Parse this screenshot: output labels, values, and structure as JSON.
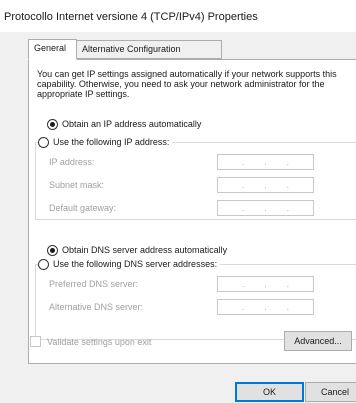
{
  "window": {
    "title": "Protocollo Internet versione 4 (TCP/IPv4) Properties"
  },
  "tabs": [
    {
      "label": "General",
      "selected": true
    },
    {
      "label": "Alternative Configuration",
      "selected": false
    }
  ],
  "description": "You can get IP settings assigned automatically if your network supports this capability. Otherwise, you need to ask your network administrator for the appropriate IP settings.",
  "ip_section": {
    "auto_label": "Obtain an IP address automatically",
    "auto_selected": true,
    "manual_label": "Use the following IP address:",
    "manual_selected": false,
    "fields": [
      {
        "label": "IP address:",
        "value": ". . ."
      },
      {
        "label": "Subnet mask:",
        "value": ". . ."
      },
      {
        "label": "Default gateway:",
        "value": ". . ."
      }
    ]
  },
  "dns_section": {
    "auto_label": "Obtain DNS server address automatically",
    "auto_selected": true,
    "manual_label": "Use the following DNS server addresses:",
    "manual_selected": false,
    "fields": [
      {
        "label": "Preferred DNS server:",
        "value": ". . ."
      },
      {
        "label": "Alternative DNS server:",
        "value": ". . ."
      }
    ]
  },
  "validate": {
    "label": "Validate settings upon exit",
    "checked": false,
    "enabled": false
  },
  "buttons": {
    "advanced": "Advanced...",
    "ok": "OK",
    "cancel": "Cancel"
  }
}
